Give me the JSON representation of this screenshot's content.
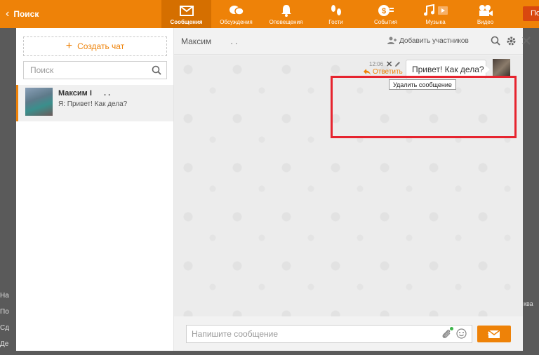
{
  "topbar": {
    "back_label": "Поиск",
    "nav": [
      {
        "label": "Сообщения",
        "icon": "envelope-icon",
        "active": true
      },
      {
        "label": "Обсуждения",
        "icon": "chat-bubbles-icon"
      },
      {
        "label": "Оповещения",
        "icon": "bell-icon"
      },
      {
        "label": "Гости",
        "icon": "footprints-icon"
      },
      {
        "label": "События",
        "icon": "events-icon"
      },
      {
        "label": "Музыка",
        "icon": "music-icon"
      },
      {
        "label": "Видео",
        "icon": "video-camera-icon"
      }
    ],
    "right_button_label": "По"
  },
  "background": {
    "left_text": [
      "На",
      "По",
      "Сд",
      "Де"
    ],
    "right_text": "ква"
  },
  "sidebar": {
    "create_chat_label": "Создать чат",
    "search_placeholder": "Поиск",
    "chats": [
      {
        "name": "Максим I",
        "extra": ". .",
        "preview": "Я: Привет! Как дела?"
      }
    ]
  },
  "conversation": {
    "title": "Максим",
    "title_extra": ". .",
    "add_participants_label": "Добавить участников",
    "messages": [
      {
        "time": "12:06",
        "text": "Привет! Как дела?",
        "reply_label": "Ответить",
        "tooltip": "Удалить сообщение"
      }
    ],
    "input_placeholder": "Напишите сообщение"
  },
  "colors": {
    "accent": "#ee8208",
    "highlight": "#e6242f"
  }
}
